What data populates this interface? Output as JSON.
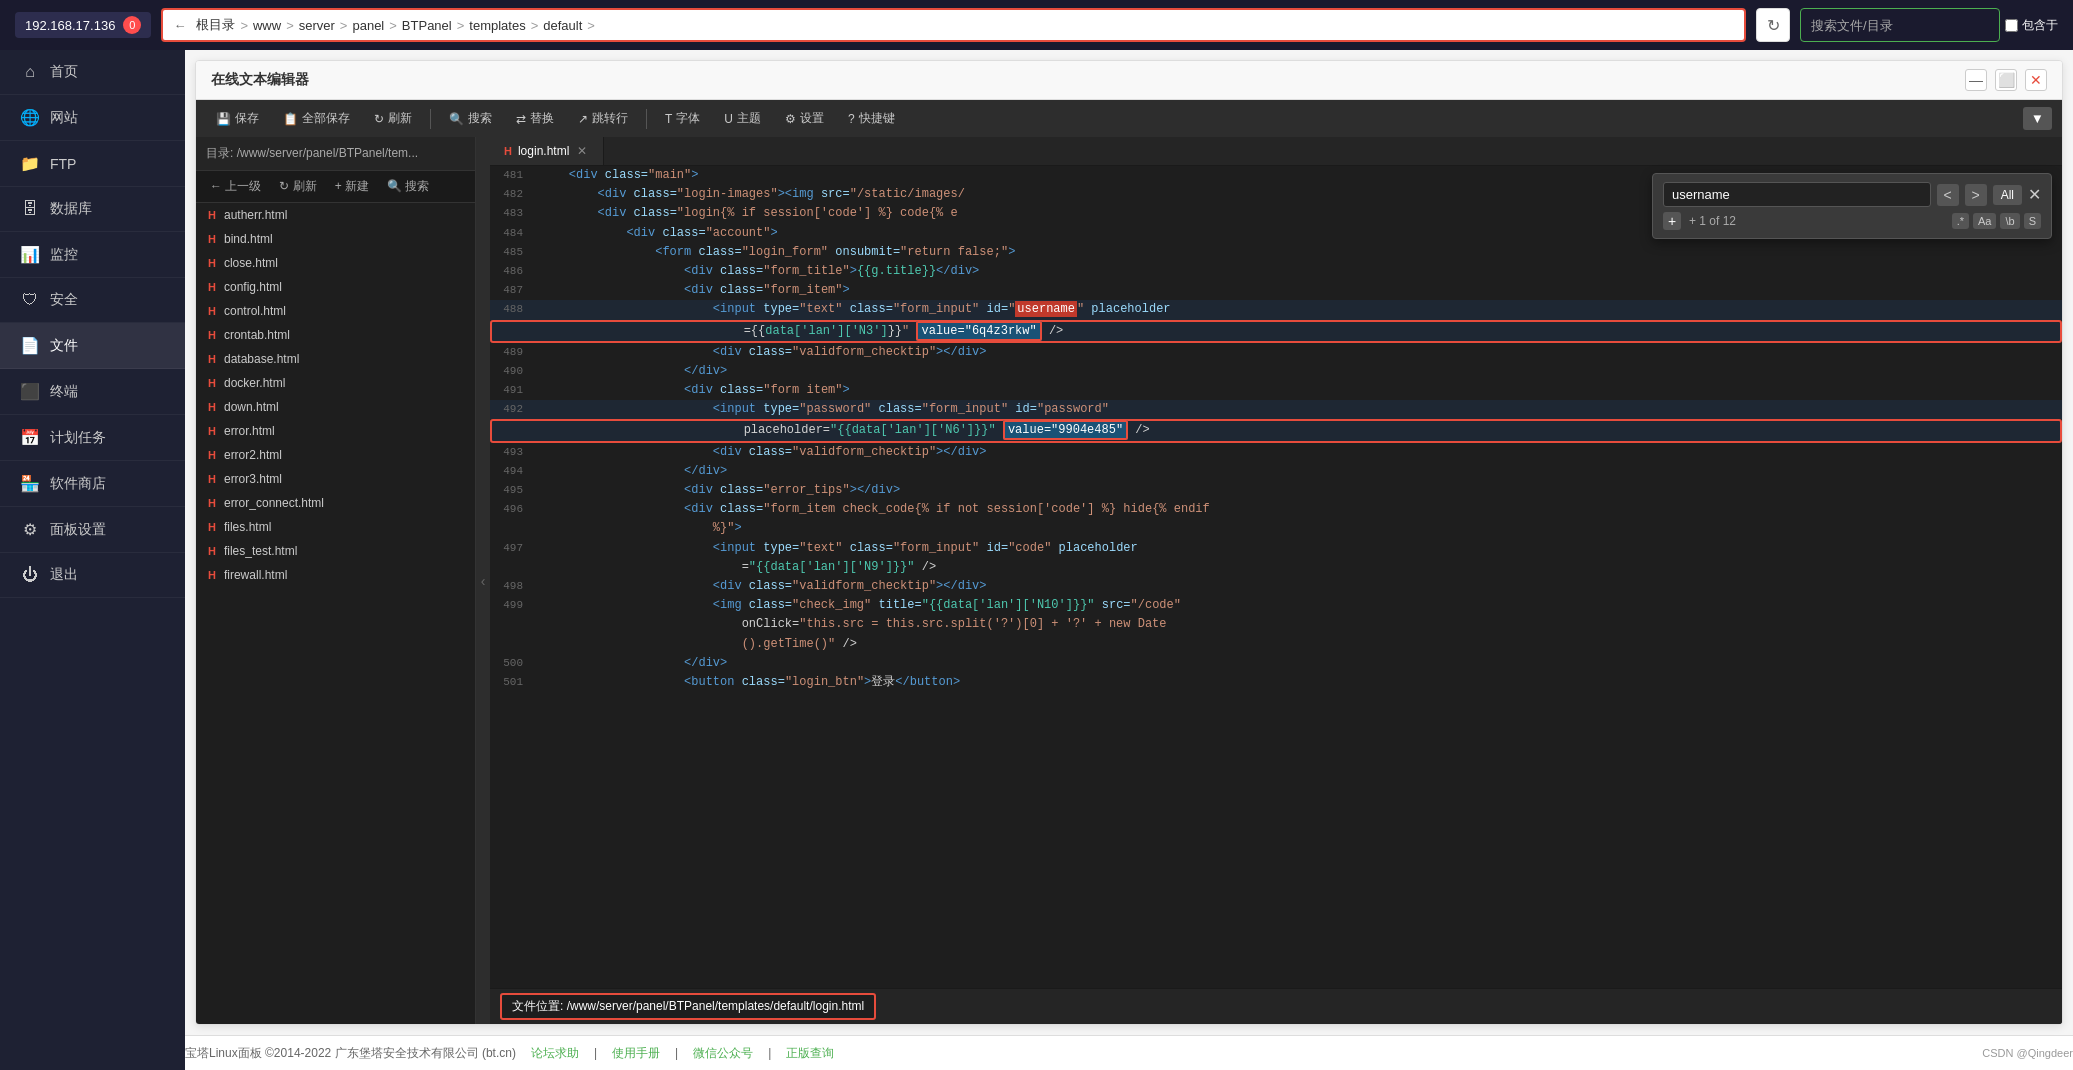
{
  "topbar": {
    "server_ip": "192.168.17.136",
    "notification_count": "0",
    "breadcrumb": {
      "back": "←",
      "items": [
        "根目录",
        "www",
        "server",
        "panel",
        "BTPanel",
        "templates",
        "default"
      ]
    },
    "search_placeholder": "搜索文件/目录",
    "contains_label": "包含于"
  },
  "sidebar": {
    "items": [
      {
        "id": "home",
        "icon": "⌂",
        "label": "首页"
      },
      {
        "id": "website",
        "icon": "🌐",
        "label": "网站"
      },
      {
        "id": "ftp",
        "icon": "📁",
        "label": "FTP"
      },
      {
        "id": "database",
        "icon": "🗄",
        "label": "数据库"
      },
      {
        "id": "monitor",
        "icon": "📊",
        "label": "监控"
      },
      {
        "id": "security",
        "icon": "🛡",
        "label": "安全"
      },
      {
        "id": "files",
        "icon": "📄",
        "label": "文件",
        "active": true
      },
      {
        "id": "terminal",
        "icon": "⬛",
        "label": "终端"
      },
      {
        "id": "crontab",
        "icon": "📅",
        "label": "计划任务"
      },
      {
        "id": "store",
        "icon": "🏪",
        "label": "软件商店"
      },
      {
        "id": "panel",
        "icon": "⚙",
        "label": "面板设置"
      },
      {
        "id": "logout",
        "icon": "⏻",
        "label": "退出"
      }
    ]
  },
  "editor": {
    "title": "在线文本编辑器",
    "window_controls": {
      "minimize": "—",
      "maximize": "⬜",
      "close": "✕"
    },
    "toolbar": {
      "save": "保存",
      "save_all": "全部保存",
      "refresh": "刷新",
      "search": "搜索",
      "replace": "替换",
      "jump": "跳转行",
      "font": "字体",
      "theme": "主题",
      "settings": "设置",
      "shortcuts": "快捷键"
    },
    "file_panel": {
      "dir_label": "目录: /www/server/panel/BTPanel/tem...",
      "nav_buttons": [
        "← 上一级",
        "↻ 刷新",
        "+ 新建",
        "🔍 搜索"
      ],
      "files": [
        "autherr.html",
        "bind.html",
        "close.html",
        "config.html",
        "control.html",
        "crontab.html",
        "database.html",
        "docker.html",
        "down.html",
        "error.html",
        "error2.html",
        "error3.html",
        "error_connect.html",
        "files.html",
        "files_test.html",
        "firewall.html"
      ]
    },
    "tab": {
      "name": "login.html",
      "icon": "H"
    },
    "search_widget": {
      "label": "username",
      "nav_prev": "<",
      "nav_next": ">",
      "all_btn": "All",
      "close_btn": "✕",
      "count": "+ 1 of 12",
      "flag_dot": ".*",
      "flag_aa": "Aa",
      "flag_wb": "\\b",
      "flag_s": "S"
    },
    "code_lines": [
      {
        "num": "481",
        "content": "    <div class=\"main\">"
      },
      {
        "num": "482",
        "content": "        <div class=\"login-images\"><img src=\"/static/images/"
      },
      {
        "num": "483",
        "content": "        <div class=\"login{% if session['code'] %} code{% e"
      },
      {
        "num": "484",
        "content": "            <div class=\"account\">"
      },
      {
        "num": "485",
        "content": "                <form class=\"login_form\" onsubmit=\"return false;\">"
      },
      {
        "num": "486",
        "content": "                    <div class=\"form_title\">{{g.title}}</div>"
      },
      {
        "num": "487",
        "content": "                    <div class=\"form_item\">"
      },
      {
        "num": "488",
        "content": "                        <input type=\"text\" class=\"form_input\" id=\"username\" placeholder"
      },
      {
        "num": "",
        "content": "                            ={{data['lan']['N3']}}}\" value=\"6q4z3rkw\" />"
      },
      {
        "num": "489",
        "content": "                        <div class=\"validform_checktip\"></div>"
      },
      {
        "num": "490",
        "content": "                    </div>"
      },
      {
        "num": "491",
        "content": "                    <div class=\"form item\">"
      },
      {
        "num": "492",
        "content": "                        <input type=\"password\" class=\"form_input\" id=\"password\""
      },
      {
        "num": "",
        "content": "                            placeholder=\"{{data['lan']['N6']}}\" value=\"9904e485\" />"
      },
      {
        "num": "493",
        "content": "                        <div class=\"validform_checktip\"></div>"
      },
      {
        "num": "494",
        "content": "                    </div>"
      },
      {
        "num": "495",
        "content": "                    <div class=\"error_tips\"></div>"
      },
      {
        "num": "496",
        "content": "                    <div class=\"form_item check_code{% if not session['code'] %} hide{% endif"
      },
      {
        "num": "",
        "content": "                        %}\">"
      },
      {
        "num": "497",
        "content": "                        <input type=\"text\" class=\"form_input\" id=\"code\" placeholder"
      },
      {
        "num": "",
        "content": "                            =\"{{data['lan']['N9']}}\" />"
      },
      {
        "num": "498",
        "content": "                        <div class=\"validform_checktip\"></div>"
      },
      {
        "num": "499",
        "content": "                        <img class=\"check_img\" title=\"{{data['lan']['N10']}}\" src=\"/code\""
      },
      {
        "num": "",
        "content": "                            onClick=\"this.src = this.src.split('?')[0] + '?' + new Date"
      },
      {
        "num": "",
        "content": "                            ().getTime()\" />"
      },
      {
        "num": "500",
        "content": "                    </div>"
      },
      {
        "num": "501",
        "content": "                    <button class=\"login_btn\">登录</button>"
      }
    ],
    "status_bar": {
      "file_location": "文件位置: /www/server/panel/BTPanel/templates/default/login.html"
    }
  },
  "footer": {
    "copyright": "宝塔Linux面板 ©2014-2022 广东堡塔安全技术有限公司 (bt.cn)",
    "links": [
      "论坛求助",
      "使用手册",
      "微信公众号",
      "正版查询"
    ],
    "right": "CSDN @Qingdeer"
  }
}
